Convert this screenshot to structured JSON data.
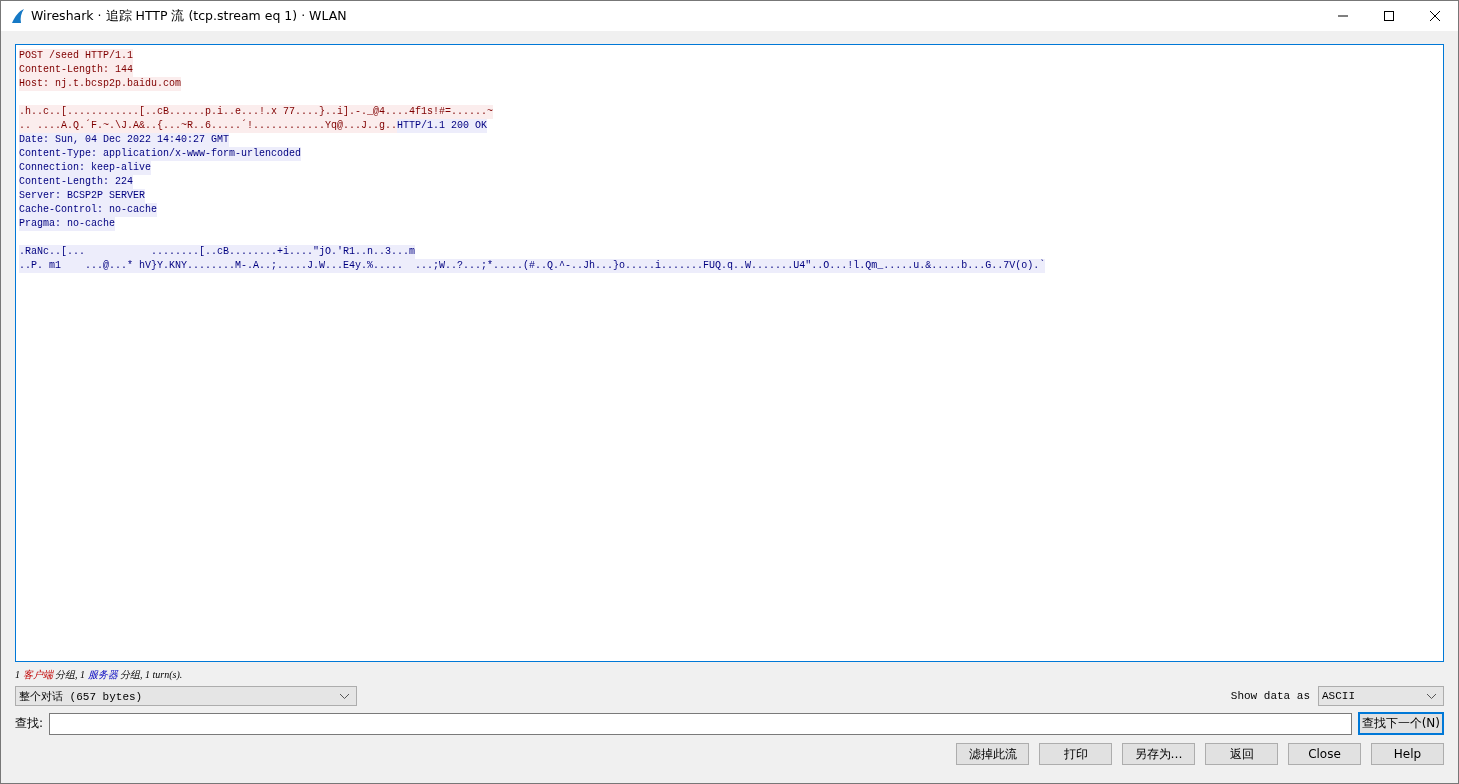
{
  "window": {
    "title": "Wireshark · 追踪 HTTP 流 (tcp.stream eq 1) · WLAN"
  },
  "stream": [
    {
      "kind": "text",
      "segments": [
        {
          "from_server": false,
          "text": "POST /seed HTTP/1.1"
        }
      ]
    },
    {
      "kind": "text",
      "segments": [
        {
          "from_server": false,
          "text": "Content-Length: 144"
        }
      ]
    },
    {
      "kind": "text",
      "segments": [
        {
          "from_server": false,
          "text": "Host: nj.t.bcsp2p.baidu.com"
        }
      ]
    },
    {
      "kind": "blank"
    },
    {
      "kind": "text",
      "segments": [
        {
          "from_server": false,
          "text": ".h..c..[............[..cB......p.i..e...!.x 77....}..i].-._@4....4f1s!#=......~"
        }
      ]
    },
    {
      "kind": "text",
      "segments": [
        {
          "from_server": false,
          "text": ".. ....A.Q.´F.~.\\J.A&..{...~R..6.....´!............Yq@...J..g.."
        },
        {
          "from_server": true,
          "text": "HTTP/1.1 200 OK"
        }
      ]
    },
    {
      "kind": "text",
      "segments": [
        {
          "from_server": true,
          "text": "Date: Sun, 04 Dec 2022 14:40:27 GMT"
        }
      ]
    },
    {
      "kind": "text",
      "segments": [
        {
          "from_server": true,
          "text": "Content-Type: application/x-www-form-urlencoded"
        }
      ]
    },
    {
      "kind": "text",
      "segments": [
        {
          "from_server": true,
          "text": "Connection: keep-alive"
        }
      ]
    },
    {
      "kind": "text",
      "segments": [
        {
          "from_server": true,
          "text": "Content-Length: 224"
        }
      ]
    },
    {
      "kind": "text",
      "segments": [
        {
          "from_server": true,
          "text": "Server: BCSP2P SERVER"
        }
      ]
    },
    {
      "kind": "text",
      "segments": [
        {
          "from_server": true,
          "text": "Cache-Control: no-cache"
        }
      ]
    },
    {
      "kind": "text",
      "segments": [
        {
          "from_server": true,
          "text": "Pragma: no-cache"
        }
      ]
    },
    {
      "kind": "blank"
    },
    {
      "kind": "text",
      "segments": [
        {
          "from_server": true,
          "text": ".RaNc..[...           ........[..cB........+i....\"jO.'R1..n..3...m"
        }
      ]
    },
    {
      "kind": "text",
      "segments": [
        {
          "from_server": true,
          "text": "..P. m1    ...@...* hV}Y.KNY........M-.A..;.....J.W...E4y.%.....  ...;W..?...;*.....(#..Q.^-..Jh...}o.....i.......FUQ.q..W.......U4\"..O...!l.Qm_.....u.&.....b...G..7V(o).`"
        }
      ]
    }
  ],
  "summary": [
    {
      "kind": "plain",
      "text": "1 "
    },
    {
      "kind": "client",
      "text": "客户端"
    },
    {
      "kind": "plain",
      "text": " 分组, 1 "
    },
    {
      "kind": "server",
      "text": "服务器"
    },
    {
      "kind": "plain",
      "text": " 分组, 1 turn(s)."
    }
  ],
  "conversation_select": {
    "value": "整个对话 (657 bytes)"
  },
  "show_data_as": {
    "label": "Show data as",
    "value": "ASCII"
  },
  "find": {
    "label": "查找:",
    "button": "查找下一个(N)"
  },
  "buttons": [
    "滤掉此流",
    "打印",
    "另存为…",
    "返回",
    "Close",
    "Help"
  ]
}
